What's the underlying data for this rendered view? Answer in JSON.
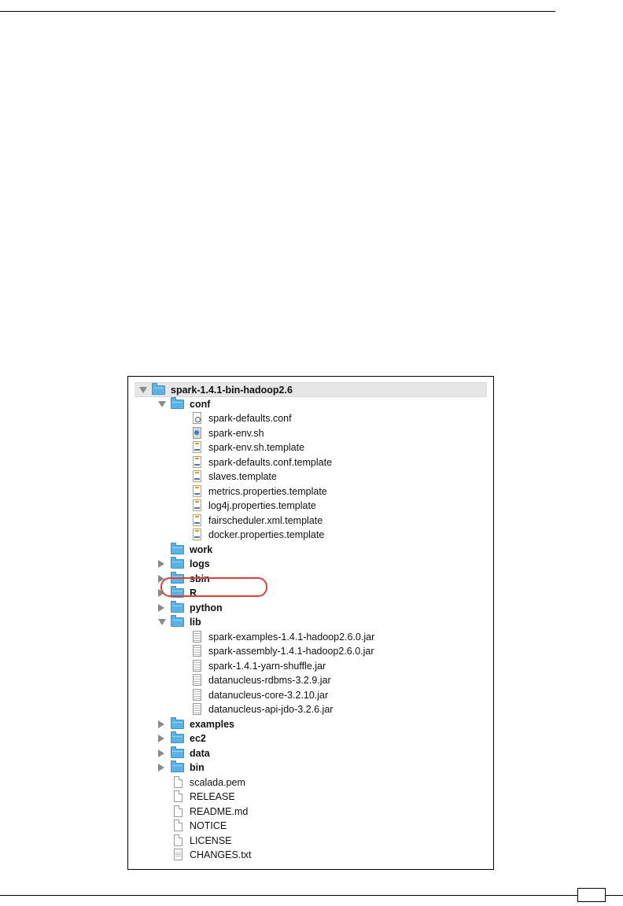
{
  "page": {
    "number": ""
  },
  "finder": {
    "items": [
      {
        "label": "spark-1.4.1-bin-hadoop2.6",
        "kind": "folder",
        "level": 0,
        "disclosure": "open",
        "bold": true,
        "root": true
      },
      {
        "label": "conf",
        "kind": "folder",
        "level": 1,
        "disclosure": "open",
        "bold": true
      },
      {
        "label": "spark-defaults.conf",
        "kind": "conf",
        "level": 2
      },
      {
        "label": "spark-env.sh",
        "kind": "script",
        "level": 2
      },
      {
        "label": "spark-env.sh.template",
        "kind": "template",
        "level": 2
      },
      {
        "label": "spark-defaults.conf.template",
        "kind": "template",
        "level": 2
      },
      {
        "label": "slaves.template",
        "kind": "template",
        "level": 2
      },
      {
        "label": "metrics.properties.template",
        "kind": "template",
        "level": 2
      },
      {
        "label": "log4j.properties.template",
        "kind": "template",
        "level": 2
      },
      {
        "label": "fairscheduler.xml.template",
        "kind": "template",
        "level": 2
      },
      {
        "label": "docker.properties.template",
        "kind": "template",
        "level": 2
      },
      {
        "label": "work",
        "kind": "folder",
        "level": 1,
        "disclosure": "none",
        "bold": true
      },
      {
        "label": "logs",
        "kind": "folder",
        "level": 1,
        "disclosure": "closed",
        "bold": true
      },
      {
        "label": "sbin",
        "kind": "folder",
        "level": 1,
        "disclosure": "closed",
        "bold": true
      },
      {
        "label": "R",
        "kind": "folder",
        "level": 1,
        "disclosure": "closed",
        "bold": true
      },
      {
        "label": "python",
        "kind": "folder",
        "level": 1,
        "disclosure": "closed",
        "bold": true
      },
      {
        "label": "lib",
        "kind": "folder",
        "level": 1,
        "disclosure": "open",
        "bold": true
      },
      {
        "label": "spark-examples-1.4.1-hadoop2.6.0.jar",
        "kind": "jar",
        "level": 2
      },
      {
        "label": "spark-assembly-1.4.1-hadoop2.6.0.jar",
        "kind": "jar",
        "level": 2
      },
      {
        "label": "spark-1.4.1-yarn-shuffle.jar",
        "kind": "jar",
        "level": 2
      },
      {
        "label": "datanucleus-rdbms-3.2.9.jar",
        "kind": "jar",
        "level": 2
      },
      {
        "label": "datanucleus-core-3.2.10.jar",
        "kind": "jar",
        "level": 2
      },
      {
        "label": "datanucleus-api-jdo-3.2.6.jar",
        "kind": "jar",
        "level": 2
      },
      {
        "label": "examples",
        "kind": "folder",
        "level": 1,
        "disclosure": "closed",
        "bold": true
      },
      {
        "label": "ec2",
        "kind": "folder",
        "level": 1,
        "disclosure": "closed",
        "bold": true
      },
      {
        "label": "data",
        "kind": "folder",
        "level": 1,
        "disclosure": "closed",
        "bold": true
      },
      {
        "label": "bin",
        "kind": "folder",
        "level": 1,
        "disclosure": "closed",
        "bold": true
      },
      {
        "label": "scalada.pem",
        "kind": "plain",
        "level": 1,
        "highlighted": true
      },
      {
        "label": "RELEASE",
        "kind": "plain",
        "level": 1
      },
      {
        "label": "README.md",
        "kind": "plain",
        "level": 1
      },
      {
        "label": "NOTICE",
        "kind": "plain",
        "level": 1
      },
      {
        "label": "LICENSE",
        "kind": "plain",
        "level": 1
      },
      {
        "label": "CHANGES.txt",
        "kind": "txt",
        "level": 1
      }
    ],
    "colors": {
      "folder": "#5ab2e6",
      "highlight": "#e0403a",
      "root_row": "#e6e6e6"
    }
  }
}
